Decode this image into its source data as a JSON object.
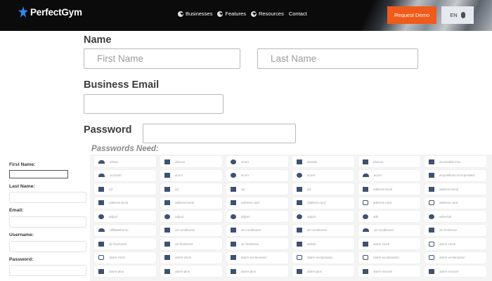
{
  "header": {
    "logo_text": "PerfectGym",
    "nav": [
      "Businesses",
      "Features",
      "Resources",
      "Contact"
    ],
    "request_demo": "Request Demo",
    "lang": "EN"
  },
  "form": {
    "name_label": "Name",
    "first_name_placeholder": "First Name",
    "last_name_placeholder": "Last Name",
    "email_label": "Business Email",
    "password_label": "Password",
    "passwords_need": "Passwords Need:"
  },
  "sidebar": {
    "first_name": "First Name:",
    "last_name": "Last Name:",
    "email": "Email:",
    "username": "Username:",
    "password": "Password:"
  },
  "icon_grid": {
    "icon_color": "#3f5170",
    "rows": [
      [
        {
          "icon": "t",
          "text": "500px"
        },
        {
          "icon": "b",
          "text": "abacus"
        },
        {
          "icon": "r",
          "text": "acorn"
        },
        {
          "icon": "b",
          "text": "abstain"
        },
        {
          "icon": "b",
          "text": "abacus"
        },
        {
          "icon": "b",
          "text": "accessible-icon"
        }
      ],
      [
        {
          "icon": "t",
          "text": "accusoft"
        },
        {
          "icon": "b",
          "text": "acorn"
        },
        {
          "icon": "r",
          "text": "acorn"
        },
        {
          "icon": "r",
          "text": "acorn"
        },
        {
          "icon": "t",
          "text": "acorn"
        },
        {
          "icon": "b",
          "text": "acquisitions-incorporated"
        }
      ],
      [
        {
          "icon": "b",
          "text": "ad"
        },
        {
          "icon": "b",
          "text": "ad"
        },
        {
          "icon": "b",
          "text": "ad"
        },
        {
          "icon": "b",
          "text": "ad"
        },
        {
          "icon": "b",
          "text": "address-book"
        },
        {
          "icon": "b",
          "text": "address-book"
        }
      ],
      [
        {
          "icon": "b",
          "text": "address-book"
        },
        {
          "icon": "b",
          "text": "address-book"
        },
        {
          "icon": "b",
          "text": "address-card"
        },
        {
          "icon": "b",
          "text": "address-card"
        },
        {
          "icon": "o",
          "text": "address-card"
        },
        {
          "icon": "o",
          "text": "address-card"
        }
      ],
      [
        {
          "icon": "r",
          "text": "adjust"
        },
        {
          "icon": "r",
          "text": "adjust"
        },
        {
          "icon": "r",
          "text": "adjust"
        },
        {
          "icon": "r",
          "text": "adjust"
        },
        {
          "icon": "r",
          "text": "adn"
        },
        {
          "icon": "r",
          "text": "adversal"
        }
      ],
      [
        {
          "icon": "t",
          "text": "affiliatetheme"
        },
        {
          "icon": "b",
          "text": "air-conditioner"
        },
        {
          "icon": "b",
          "text": "air-conditioner"
        },
        {
          "icon": "b",
          "text": "air-conditioner"
        },
        {
          "icon": "t",
          "text": "air-conditioner"
        },
        {
          "icon": "b",
          "text": "air-freshener"
        }
      ],
      [
        {
          "icon": "b",
          "text": "air-freshener"
        },
        {
          "icon": "b",
          "text": "air-freshener"
        },
        {
          "icon": "b",
          "text": "air-freshener"
        },
        {
          "icon": "b",
          "text": "airbnb"
        },
        {
          "icon": "b",
          "text": "alarm-clock"
        },
        {
          "icon": "o",
          "text": "alarm-clock"
        }
      ],
      [
        {
          "icon": "o",
          "text": "alarm-clock"
        },
        {
          "icon": "b",
          "text": "alarm-clock"
        },
        {
          "icon": "b",
          "text": "alarm-exclamation"
        },
        {
          "icon": "o",
          "text": "alarm-exclamation"
        },
        {
          "icon": "o",
          "text": "alarm-exclamation"
        },
        {
          "icon": "o",
          "text": "alarm-exclamation"
        }
      ],
      [
        {
          "icon": "b",
          "text": "alarm-plus"
        },
        {
          "icon": "b",
          "text": "alarm-plus"
        },
        {
          "icon": "b",
          "text": "alarm-plus"
        },
        {
          "icon": "b",
          "text": "alarm-plus"
        },
        {
          "icon": "b",
          "text": "alarm-snooze"
        },
        {
          "icon": "b",
          "text": "alarm-snooze"
        }
      ]
    ]
  }
}
